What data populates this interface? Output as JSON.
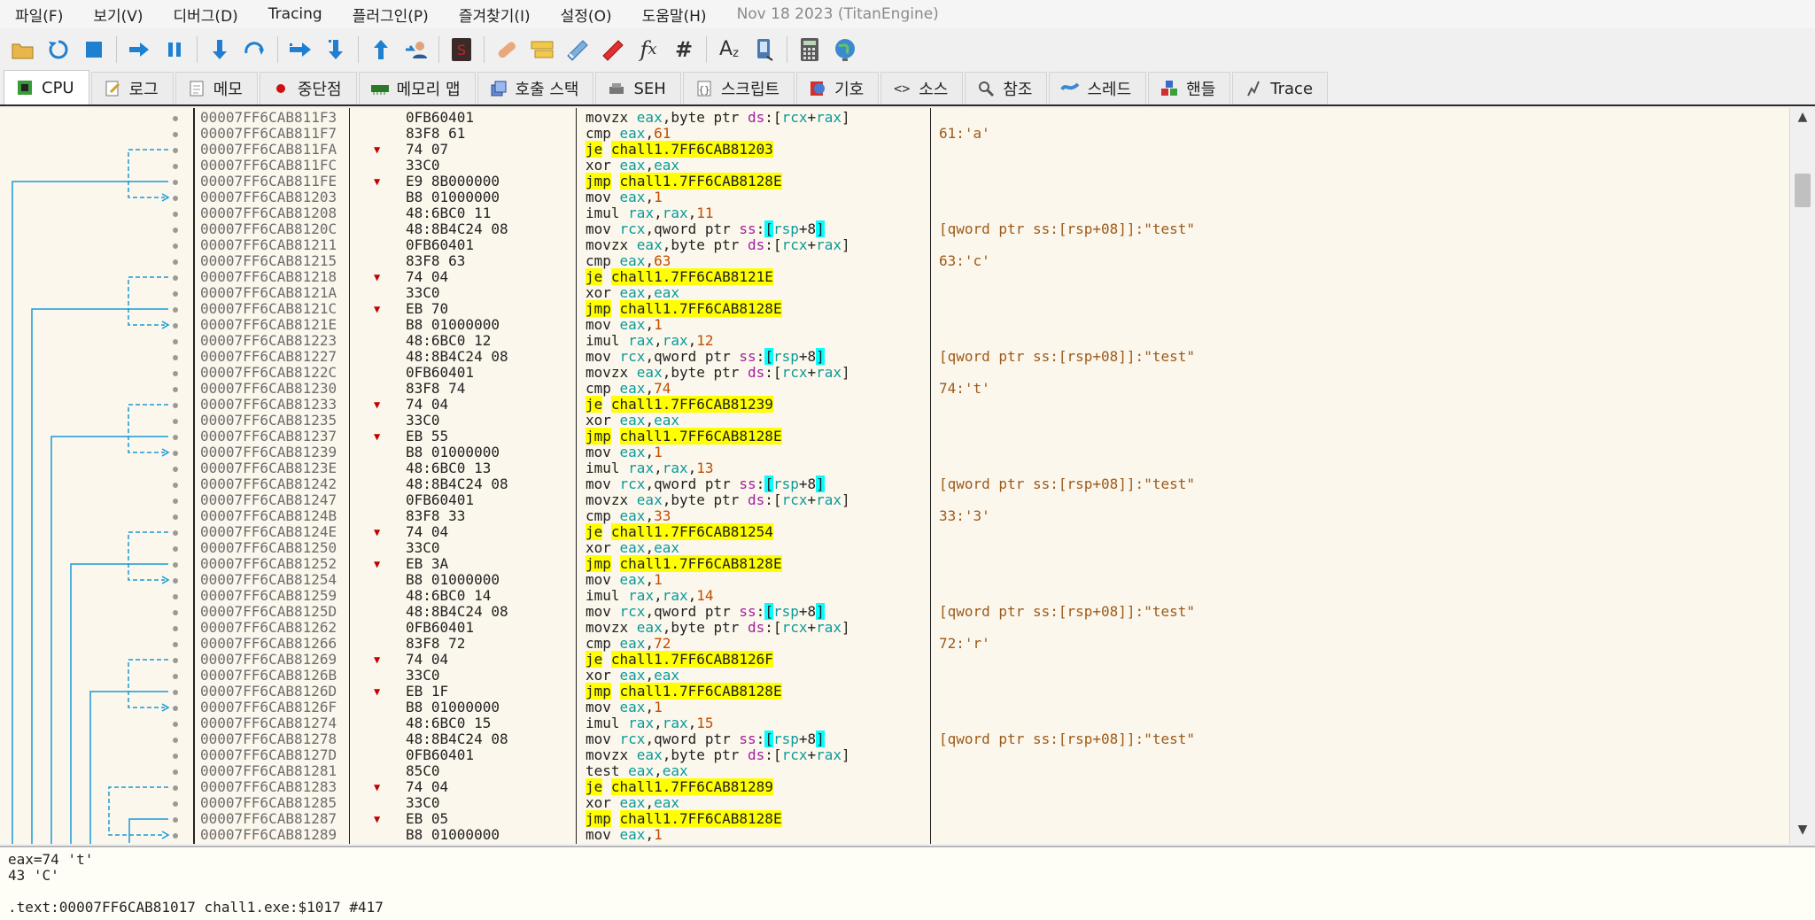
{
  "menu": {
    "items": [
      "파일(F)",
      "보기(V)",
      "디버그(D)",
      "Tracing",
      "플러그인(P)",
      "즐겨찾기(I)",
      "설정(O)",
      "도움말(H)"
    ],
    "build_date": "Nov 18 2023 (TitanEngine)"
  },
  "toolbar": {
    "buttons": [
      "open-icon",
      "restart-icon",
      "stop-icon",
      "run-icon",
      "pause-icon",
      "step-into-icon",
      "step-over-icon",
      "trace-into-icon",
      "trace-over-icon",
      "execute-till-return-icon",
      "run-to-user-code-icon",
      "scylla-icon",
      "patch-icon",
      "comment-icon",
      "label-icon",
      "bookmark-icon",
      "function-icon",
      "hash-icon",
      "strings-icon",
      "device-icon",
      "calculator-icon",
      "globe-icon"
    ]
  },
  "tabs": [
    {
      "label": "CPU",
      "icon": "cpu-icon",
      "active": true
    },
    {
      "label": "로그",
      "icon": "log-icon"
    },
    {
      "label": "메모",
      "icon": "notes-icon"
    },
    {
      "label": "중단점",
      "icon": "breakpoint-icon"
    },
    {
      "label": "메모리 맵",
      "icon": "memory-map-icon"
    },
    {
      "label": "호출 스택",
      "icon": "call-stack-icon"
    },
    {
      "label": "SEH",
      "icon": "seh-icon"
    },
    {
      "label": "스크립트",
      "icon": "script-icon"
    },
    {
      "label": "기호",
      "icon": "symbols-icon"
    },
    {
      "label": "소스",
      "icon": "source-icon"
    },
    {
      "label": "참조",
      "icon": "references-icon"
    },
    {
      "label": "스레드",
      "icon": "threads-icon"
    },
    {
      "label": "핸들",
      "icon": "handles-icon"
    },
    {
      "label": "Trace",
      "icon": "trace-icon"
    }
  ],
  "colors": {
    "jump_line": "#1a9ad6",
    "highlight_yellow": "#ffff00",
    "highlight_cyan": "#00ffff",
    "comment": "#9c5a1a",
    "register": "#0a9a9a"
  },
  "disassembly": [
    {
      "addr": "00007FF6CAB811F3",
      "bytes": "0FB60401",
      "instr": "movzx eax,byte ptr ds:[rcx+rax]",
      "comment": ""
    },
    {
      "addr": "00007FF6CAB811F7",
      "bytes": "83F8 61",
      "instr": "cmp eax,61",
      "comment": "61:'a'"
    },
    {
      "addr": "00007FF6CAB811FA",
      "bytes": "74 07",
      "instr": "je chall1.7FF6CAB81203",
      "comment": "",
      "jump": true,
      "hl": "je"
    },
    {
      "addr": "00007FF6CAB811FC",
      "bytes": "33C0",
      "instr": "xor eax,eax",
      "comment": ""
    },
    {
      "addr": "00007FF6CAB811FE",
      "bytes": "E9 8B000000",
      "instr": "jmp chall1.7FF6CAB8128E",
      "comment": "",
      "jump": true,
      "hl": "jmp"
    },
    {
      "addr": "00007FF6CAB81203",
      "bytes": "B8 01000000",
      "instr": "mov eax,1",
      "comment": ""
    },
    {
      "addr": "00007FF6CAB81208",
      "bytes": "48:6BC0 11",
      "instr": "imul rax,rax,11",
      "comment": ""
    },
    {
      "addr": "00007FF6CAB8120C",
      "bytes": "48:8B4C24 08",
      "instr": "mov rcx,qword ptr ss:[rsp+8]",
      "comment": "[qword ptr ss:[rsp+08]]:\"test\"",
      "rsp": true
    },
    {
      "addr": "00007FF6CAB81211",
      "bytes": "0FB60401",
      "instr": "movzx eax,byte ptr ds:[rcx+rax]",
      "comment": ""
    },
    {
      "addr": "00007FF6CAB81215",
      "bytes": "83F8 63",
      "instr": "cmp eax,63",
      "comment": "63:'c'"
    },
    {
      "addr": "00007FF6CAB81218",
      "bytes": "74 04",
      "instr": "je chall1.7FF6CAB8121E",
      "comment": "",
      "jump": true,
      "hl": "je"
    },
    {
      "addr": "00007FF6CAB8121A",
      "bytes": "33C0",
      "instr": "xor eax,eax",
      "comment": ""
    },
    {
      "addr": "00007FF6CAB8121C",
      "bytes": "EB 70",
      "instr": "jmp chall1.7FF6CAB8128E",
      "comment": "",
      "jump": true,
      "hl": "jmp"
    },
    {
      "addr": "00007FF6CAB8121E",
      "bytes": "B8 01000000",
      "instr": "mov eax,1",
      "comment": ""
    },
    {
      "addr": "00007FF6CAB81223",
      "bytes": "48:6BC0 12",
      "instr": "imul rax,rax,12",
      "comment": ""
    },
    {
      "addr": "00007FF6CAB81227",
      "bytes": "48:8B4C24 08",
      "instr": "mov rcx,qword ptr ss:[rsp+8]",
      "comment": "[qword ptr ss:[rsp+08]]:\"test\"",
      "rsp": true
    },
    {
      "addr": "00007FF6CAB8122C",
      "bytes": "0FB60401",
      "instr": "movzx eax,byte ptr ds:[rcx+rax]",
      "comment": ""
    },
    {
      "addr": "00007FF6CAB81230",
      "bytes": "83F8 74",
      "instr": "cmp eax,74",
      "comment": "74:'t'"
    },
    {
      "addr": "00007FF6CAB81233",
      "bytes": "74 04",
      "instr": "je chall1.7FF6CAB81239",
      "comment": "",
      "jump": true,
      "hl": "je"
    },
    {
      "addr": "00007FF6CAB81235",
      "bytes": "33C0",
      "instr": "xor eax,eax",
      "comment": ""
    },
    {
      "addr": "00007FF6CAB81237",
      "bytes": "EB 55",
      "instr": "jmp chall1.7FF6CAB8128E",
      "comment": "",
      "jump": true,
      "hl": "jmp"
    },
    {
      "addr": "00007FF6CAB81239",
      "bytes": "B8 01000000",
      "instr": "mov eax,1",
      "comment": ""
    },
    {
      "addr": "00007FF6CAB8123E",
      "bytes": "48:6BC0 13",
      "instr": "imul rax,rax,13",
      "comment": ""
    },
    {
      "addr": "00007FF6CAB81242",
      "bytes": "48:8B4C24 08",
      "instr": "mov rcx,qword ptr ss:[rsp+8]",
      "comment": "[qword ptr ss:[rsp+08]]:\"test\"",
      "rsp": true
    },
    {
      "addr": "00007FF6CAB81247",
      "bytes": "0FB60401",
      "instr": "movzx eax,byte ptr ds:[rcx+rax]",
      "comment": ""
    },
    {
      "addr": "00007FF6CAB8124B",
      "bytes": "83F8 33",
      "instr": "cmp eax,33",
      "comment": "33:'3'"
    },
    {
      "addr": "00007FF6CAB8124E",
      "bytes": "74 04",
      "instr": "je chall1.7FF6CAB81254",
      "comment": "",
      "jump": true,
      "hl": "je"
    },
    {
      "addr": "00007FF6CAB81250",
      "bytes": "33C0",
      "instr": "xor eax,eax",
      "comment": ""
    },
    {
      "addr": "00007FF6CAB81252",
      "bytes": "EB 3A",
      "instr": "jmp chall1.7FF6CAB8128E",
      "comment": "",
      "jump": true,
      "hl": "jmp"
    },
    {
      "addr": "00007FF6CAB81254",
      "bytes": "B8 01000000",
      "instr": "mov eax,1",
      "comment": ""
    },
    {
      "addr": "00007FF6CAB81259",
      "bytes": "48:6BC0 14",
      "instr": "imul rax,rax,14",
      "comment": ""
    },
    {
      "addr": "00007FF6CAB8125D",
      "bytes": "48:8B4C24 08",
      "instr": "mov rcx,qword ptr ss:[rsp+8]",
      "comment": "[qword ptr ss:[rsp+08]]:\"test\"",
      "rsp": true
    },
    {
      "addr": "00007FF6CAB81262",
      "bytes": "0FB60401",
      "instr": "movzx eax,byte ptr ds:[rcx+rax]",
      "comment": ""
    },
    {
      "addr": "00007FF6CAB81266",
      "bytes": "83F8 72",
      "instr": "cmp eax,72",
      "comment": "72:'r'"
    },
    {
      "addr": "00007FF6CAB81269",
      "bytes": "74 04",
      "instr": "je chall1.7FF6CAB8126F",
      "comment": "",
      "jump": true,
      "hl": "je"
    },
    {
      "addr": "00007FF6CAB8126B",
      "bytes": "33C0",
      "instr": "xor eax,eax",
      "comment": ""
    },
    {
      "addr": "00007FF6CAB8126D",
      "bytes": "EB 1F",
      "instr": "jmp chall1.7FF6CAB8128E",
      "comment": "",
      "jump": true,
      "hl": "jmp"
    },
    {
      "addr": "00007FF6CAB8126F",
      "bytes": "B8 01000000",
      "instr": "mov eax,1",
      "comment": ""
    },
    {
      "addr": "00007FF6CAB81274",
      "bytes": "48:6BC0 15",
      "instr": "imul rax,rax,15",
      "comment": ""
    },
    {
      "addr": "00007FF6CAB81278",
      "bytes": "48:8B4C24 08",
      "instr": "mov rcx,qword ptr ss:[rsp+8]",
      "comment": "[qword ptr ss:[rsp+08]]:\"test\"",
      "rsp": true
    },
    {
      "addr": "00007FF6CAB8127D",
      "bytes": "0FB60401",
      "instr": "movzx eax,byte ptr ds:[rcx+rax]",
      "comment": ""
    },
    {
      "addr": "00007FF6CAB81281",
      "bytes": "85C0",
      "instr": "test eax,eax",
      "comment": ""
    },
    {
      "addr": "00007FF6CAB81283",
      "bytes": "74 04",
      "instr": "je chall1.7FF6CAB81289",
      "comment": "",
      "jump": true,
      "hl": "je"
    },
    {
      "addr": "00007FF6CAB81285",
      "bytes": "33C0",
      "instr": "xor eax,eax",
      "comment": ""
    },
    {
      "addr": "00007FF6CAB81287",
      "bytes": "EB 05",
      "instr": "jmp chall1.7FF6CAB8128E",
      "comment": "",
      "jump": true,
      "hl": "jmp"
    },
    {
      "addr": "00007FF6CAB81289",
      "bytes": "B8 01000000",
      "instr": "mov eax,1",
      "comment": ""
    }
  ],
  "info": {
    "line1": "eax=74 't'",
    "line2": "43 'C'",
    "line3": "",
    "line4": ".text:00007FF6CAB81017 chall1.exe:$1017 #417"
  }
}
